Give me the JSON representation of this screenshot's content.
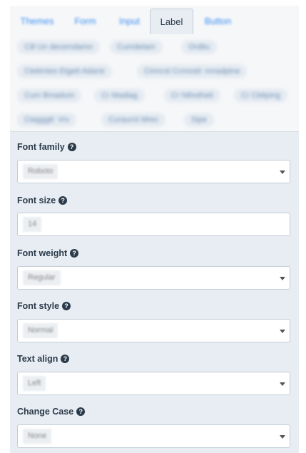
{
  "tabs": [
    {
      "label": "Themes"
    },
    {
      "label": "Form"
    },
    {
      "label": "Input"
    },
    {
      "label": "Label"
    },
    {
      "label": "Button"
    }
  ],
  "chips": [
    "Cill Un decemdamn",
    "Cumdetam",
    "Orditu",
    "Ctetimtes Etgett Adarst",
    "Cirmcsl Ccmosti: mnadptne",
    "Cum Bmadum",
    "Cr Madiag",
    "Cr Nthotheti",
    "Cr Cbitping",
    "Ctagggtl: Vrv",
    "Curaurnt Mrec",
    "Sipe"
  ],
  "fields": [
    {
      "label": "Font family",
      "value": "Roboto",
      "type": "select"
    },
    {
      "label": "Font size",
      "value": "14",
      "type": "input"
    },
    {
      "label": "Font weight",
      "value": "Regular",
      "type": "select"
    },
    {
      "label": "Font style",
      "value": "Normal",
      "type": "select"
    },
    {
      "label": "Text align",
      "value": "Left",
      "type": "select"
    },
    {
      "label": "Change Case",
      "value": "None",
      "type": "select"
    }
  ],
  "help_glyph": "?",
  "colors": {
    "tab_link": "#3b8ff0",
    "panel_bg": "#e8edf3",
    "text": "#2b3a4a"
  }
}
